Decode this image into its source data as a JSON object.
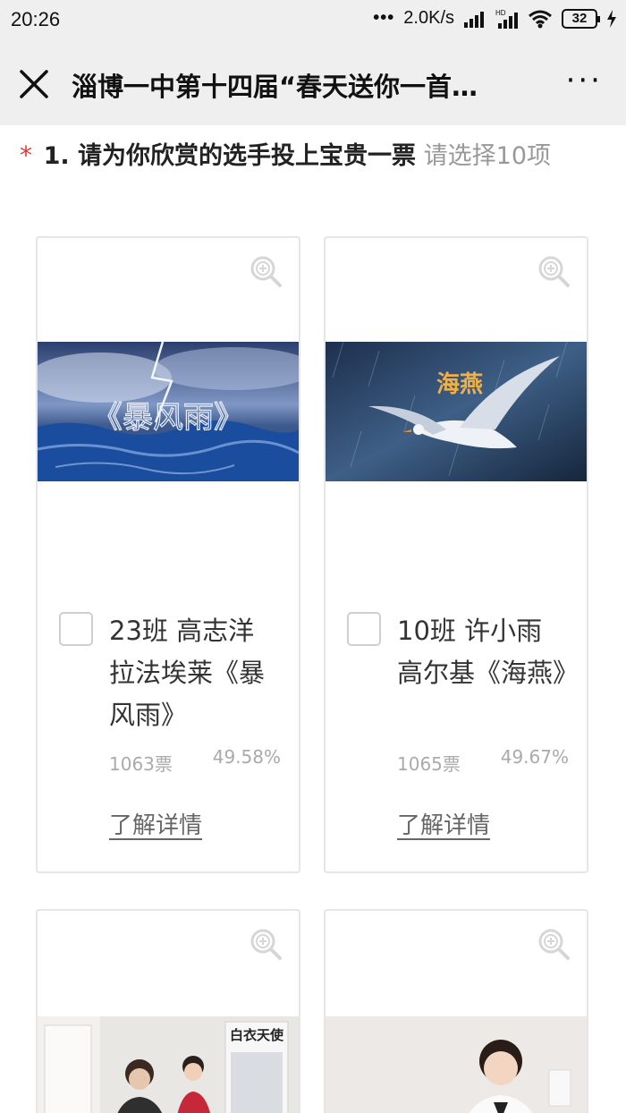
{
  "status_bar": {
    "time": "20:26",
    "net_speed": "2.0K/s",
    "battery": "32"
  },
  "nav": {
    "title": "淄博一中第十四届“春天送你一首…",
    "more": "···"
  },
  "question": {
    "required_mark": "*",
    "text": "1. 请为你欣赏的选手投上宝贵一票",
    "hint": "请选择10项"
  },
  "candidates": [
    {
      "name": "23班 高志洋 拉法埃莱《暴风雨》",
      "votes": "1063票",
      "percent": "49.58%",
      "detail": "了解详情",
      "image_text": "《暴风雨》"
    },
    {
      "name": "10班 许小雨 高尔基《海燕》",
      "votes": "1065票",
      "percent": "49.67%",
      "detail": "了解详情",
      "image_text": "海燕"
    },
    {
      "image_text": "白衣天使"
    },
    {}
  ],
  "colors": {
    "required": "#e53935",
    "hint": "#999999",
    "card_border": "#e6e6e6"
  }
}
